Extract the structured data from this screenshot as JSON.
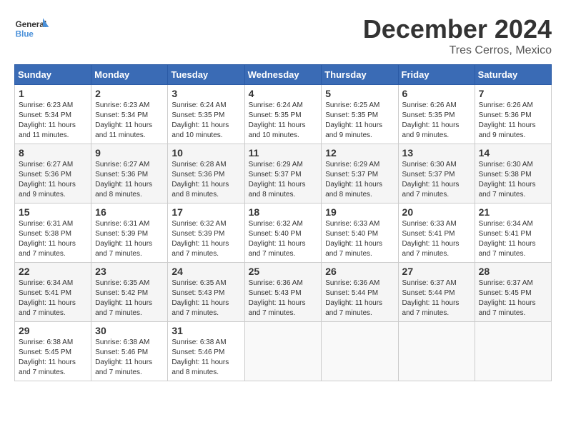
{
  "logo": {
    "text_general": "General",
    "text_blue": "Blue"
  },
  "title": {
    "month": "December 2024",
    "location": "Tres Cerros, Mexico"
  },
  "weekdays": [
    "Sunday",
    "Monday",
    "Tuesday",
    "Wednesday",
    "Thursday",
    "Friday",
    "Saturday"
  ],
  "weeks": [
    [
      {
        "day": "1",
        "sunrise": "6:23 AM",
        "sunset": "5:34 PM",
        "daylight": "11 hours and 11 minutes."
      },
      {
        "day": "2",
        "sunrise": "6:23 AM",
        "sunset": "5:34 PM",
        "daylight": "11 hours and 11 minutes."
      },
      {
        "day": "3",
        "sunrise": "6:24 AM",
        "sunset": "5:35 PM",
        "daylight": "11 hours and 10 minutes."
      },
      {
        "day": "4",
        "sunrise": "6:24 AM",
        "sunset": "5:35 PM",
        "daylight": "11 hours and 10 minutes."
      },
      {
        "day": "5",
        "sunrise": "6:25 AM",
        "sunset": "5:35 PM",
        "daylight": "11 hours and 9 minutes."
      },
      {
        "day": "6",
        "sunrise": "6:26 AM",
        "sunset": "5:35 PM",
        "daylight": "11 hours and 9 minutes."
      },
      {
        "day": "7",
        "sunrise": "6:26 AM",
        "sunset": "5:36 PM",
        "daylight": "11 hours and 9 minutes."
      }
    ],
    [
      {
        "day": "8",
        "sunrise": "6:27 AM",
        "sunset": "5:36 PM",
        "daylight": "11 hours and 9 minutes."
      },
      {
        "day": "9",
        "sunrise": "6:27 AM",
        "sunset": "5:36 PM",
        "daylight": "11 hours and 8 minutes."
      },
      {
        "day": "10",
        "sunrise": "6:28 AM",
        "sunset": "5:36 PM",
        "daylight": "11 hours and 8 minutes."
      },
      {
        "day": "11",
        "sunrise": "6:29 AM",
        "sunset": "5:37 PM",
        "daylight": "11 hours and 8 minutes."
      },
      {
        "day": "12",
        "sunrise": "6:29 AM",
        "sunset": "5:37 PM",
        "daylight": "11 hours and 8 minutes."
      },
      {
        "day": "13",
        "sunrise": "6:30 AM",
        "sunset": "5:37 PM",
        "daylight": "11 hours and 7 minutes."
      },
      {
        "day": "14",
        "sunrise": "6:30 AM",
        "sunset": "5:38 PM",
        "daylight": "11 hours and 7 minutes."
      }
    ],
    [
      {
        "day": "15",
        "sunrise": "6:31 AM",
        "sunset": "5:38 PM",
        "daylight": "11 hours and 7 minutes."
      },
      {
        "day": "16",
        "sunrise": "6:31 AM",
        "sunset": "5:39 PM",
        "daylight": "11 hours and 7 minutes."
      },
      {
        "day": "17",
        "sunrise": "6:32 AM",
        "sunset": "5:39 PM",
        "daylight": "11 hours and 7 minutes."
      },
      {
        "day": "18",
        "sunrise": "6:32 AM",
        "sunset": "5:40 PM",
        "daylight": "11 hours and 7 minutes."
      },
      {
        "day": "19",
        "sunrise": "6:33 AM",
        "sunset": "5:40 PM",
        "daylight": "11 hours and 7 minutes."
      },
      {
        "day": "20",
        "sunrise": "6:33 AM",
        "sunset": "5:41 PM",
        "daylight": "11 hours and 7 minutes."
      },
      {
        "day": "21",
        "sunrise": "6:34 AM",
        "sunset": "5:41 PM",
        "daylight": "11 hours and 7 minutes."
      }
    ],
    [
      {
        "day": "22",
        "sunrise": "6:34 AM",
        "sunset": "5:41 PM",
        "daylight": "11 hours and 7 minutes."
      },
      {
        "day": "23",
        "sunrise": "6:35 AM",
        "sunset": "5:42 PM",
        "daylight": "11 hours and 7 minutes."
      },
      {
        "day": "24",
        "sunrise": "6:35 AM",
        "sunset": "5:43 PM",
        "daylight": "11 hours and 7 minutes."
      },
      {
        "day": "25",
        "sunrise": "6:36 AM",
        "sunset": "5:43 PM",
        "daylight": "11 hours and 7 minutes."
      },
      {
        "day": "26",
        "sunrise": "6:36 AM",
        "sunset": "5:44 PM",
        "daylight": "11 hours and 7 minutes."
      },
      {
        "day": "27",
        "sunrise": "6:37 AM",
        "sunset": "5:44 PM",
        "daylight": "11 hours and 7 minutes."
      },
      {
        "day": "28",
        "sunrise": "6:37 AM",
        "sunset": "5:45 PM",
        "daylight": "11 hours and 7 minutes."
      }
    ],
    [
      {
        "day": "29",
        "sunrise": "6:38 AM",
        "sunset": "5:45 PM",
        "daylight": "11 hours and 7 minutes."
      },
      {
        "day": "30",
        "sunrise": "6:38 AM",
        "sunset": "5:46 PM",
        "daylight": "11 hours and 7 minutes."
      },
      {
        "day": "31",
        "sunrise": "6:38 AM",
        "sunset": "5:46 PM",
        "daylight": "11 hours and 8 minutes."
      },
      null,
      null,
      null,
      null
    ]
  ],
  "labels": {
    "sunrise": "Sunrise:",
    "sunset": "Sunset:",
    "daylight": "Daylight:"
  }
}
